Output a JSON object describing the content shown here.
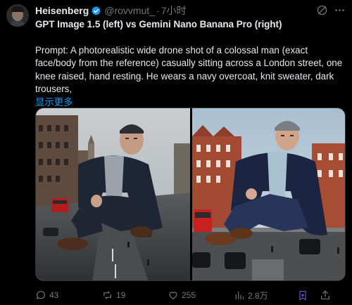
{
  "author": {
    "name": "Heisenberg",
    "handle": "@rovvmut_",
    "separator": "·",
    "time": "7小时"
  },
  "tweet": {
    "title": "GPT Image 1.5 (left) vs Gemini Nano Banana Pro (right)",
    "prompt_lines": [
      "Prompt: A photorealistic wide drone shot of a colossal man (exact",
      "face/body from the reference) casually sitting across a London street, one",
      "knee raised, hand resting. He wears a navy overcoat, knit sweater, dark",
      "trousers,"
    ],
    "show_more": "显示更多"
  },
  "actions": {
    "replies": "43",
    "reposts": "19",
    "likes": "255",
    "views": "2.8万"
  },
  "colors": {
    "accent": "#1d9bf0",
    "muted": "#71767b",
    "text": "#e7e9ea",
    "bookmark_active": "#794bc4"
  },
  "icons": [
    "verified-badge-icon",
    "grok-icon",
    "more-icon",
    "reply-icon",
    "repost-icon",
    "like-icon",
    "views-icon",
    "bookmark-icon",
    "share-icon"
  ]
}
